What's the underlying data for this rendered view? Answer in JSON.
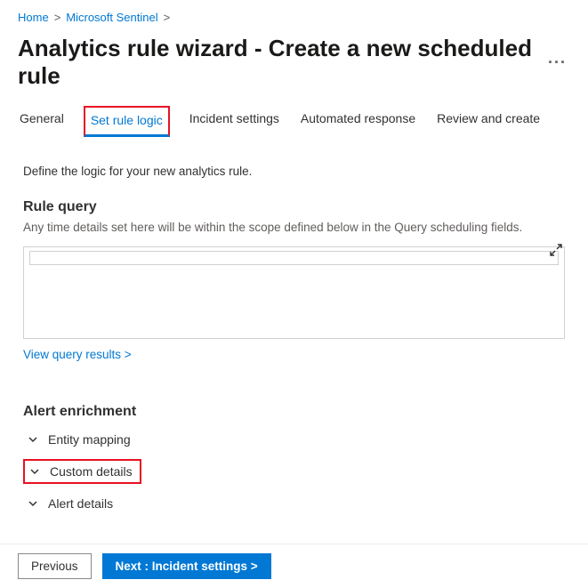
{
  "breadcrumbs": {
    "home": "Home",
    "sentinel": "Microsoft Sentinel"
  },
  "title": "Analytics rule wizard - Create a new scheduled rule",
  "tabs": {
    "general": "General",
    "setRuleLogic": "Set rule logic",
    "incidentSettings": "Incident settings",
    "automatedResponse": "Automated response",
    "reviewCreate": "Review and create"
  },
  "intro": "Define the logic for your new analytics rule.",
  "ruleQuery": {
    "heading": "Rule query",
    "desc": "Any time details set here will be within the scope defined below in the Query scheduling fields.",
    "viewResults": "View query results  >"
  },
  "alertEnrichment": {
    "heading": "Alert enrichment",
    "entityMapping": "Entity mapping",
    "customDetails": "Custom details",
    "alertDetails": "Alert details"
  },
  "footer": {
    "previous": "Previous",
    "next": "Next : Incident settings  >"
  }
}
